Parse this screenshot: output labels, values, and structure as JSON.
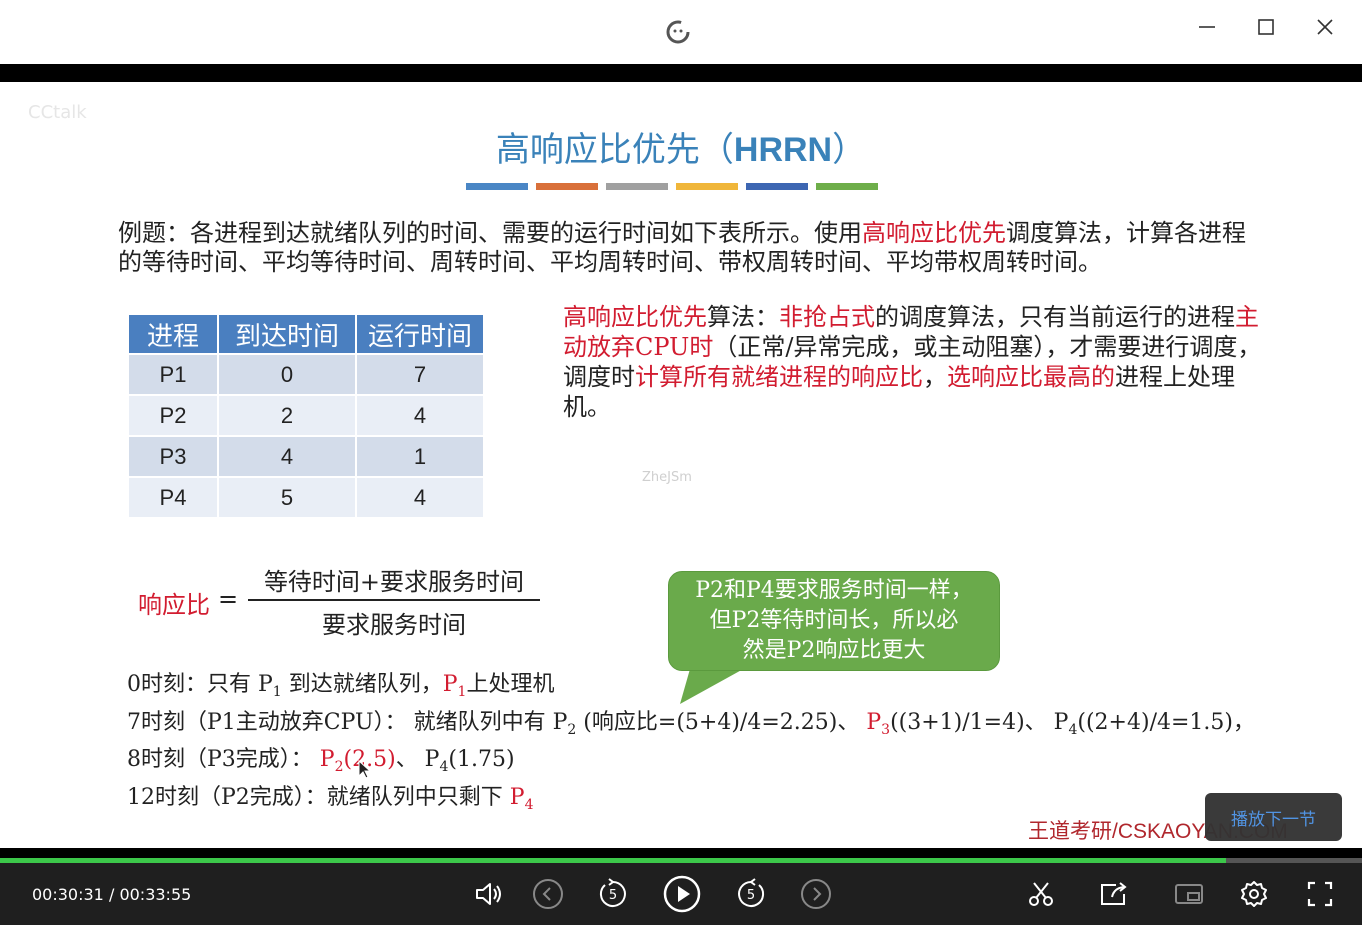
{
  "slide": {
    "watermark": "CCtalk",
    "title_cn": "高响应比优先（",
    "title_abbr": "HRRN",
    "title_close": "）",
    "colorbar_colors": [
      "#4a86c5",
      "#d9703a",
      "#a0a0a0",
      "#f0b63a",
      "#3d66b2",
      "#6eae4a"
    ],
    "problem": {
      "part1": "例题：各进程到达就绪队列的时间、需要的运行时间如下表所示。使用",
      "highlight": "高响应比优先",
      "part2": "调度算法，计算各进程的等待时间、平均等待时间、周转时间、平均周转时间、带权周转时间、平均带权周转时间。"
    },
    "table": {
      "headers": [
        "进程",
        "到达时间",
        "运行时间"
      ],
      "rows": [
        [
          "P1",
          "0",
          "7"
        ],
        [
          "P2",
          "2",
          "4"
        ],
        [
          "P3",
          "4",
          "1"
        ],
        [
          "P4",
          "5",
          "4"
        ]
      ]
    },
    "algorithm": {
      "a1": "高响应比优先",
      "a2": "算法：",
      "a3": "非抢占式",
      "a4": "的调度算法，只有当前运行的进程",
      "a5": "主动放弃CPU时",
      "a6": "（正常/异常完成，或主动阻塞），才需要进行调度，调度时",
      "a7": "计算所有就绪进程的响应比",
      "a8": "，",
      "a9": "选响应比最高的",
      "a10": "进程上处理机。"
    },
    "center_mark": "ZheJSm",
    "formula": {
      "label": "响应比",
      "eq": "=",
      "numerator": "等待时间+要求服务时间",
      "denominator": "要求服务时间"
    },
    "bubble": {
      "line1": "P2和P4要求服务时间一样，",
      "line2": "但P2等待时间长，所以必",
      "line3": "然是P2响应比更大"
    },
    "steps": {
      "s0_a": "0时刻：只有 P",
      "s0_sub1": "1",
      "s0_b": " 到达就绪队列，",
      "s0_red": "P",
      "s0_sub2": "1",
      "s0_c": "上处理机",
      "s7_a": "7时刻（P1主动放弃CPU）： 就绪队列中有 P",
      "s7_sub1": "2",
      "s7_b": " (响应比=(5+4)/4=2.25)、 ",
      "s7_red": "P",
      "s7_sub2": "3",
      "s7_c": "((3+1)/1=4)、 P",
      "s7_sub3": "4",
      "s7_d": "((2+4)/4=1.5)，",
      "s8_a": "8时刻（P3完成）： ",
      "s8_red": "P",
      "s8_sub1": "2",
      "s8_red2": "(2.5)",
      "s8_b": "、 P",
      "s8_sub2": "4",
      "s8_c": "(1.75)",
      "s12_a": "12时刻（P2完成）：就绪队列中只剩下 ",
      "s12_red": "P",
      "s12_sub": "4"
    },
    "brand": "王道考研/CSKAOYAN.COM"
  },
  "player": {
    "next_label": "播放下一节",
    "current_time": "00:30:31",
    "separator": "/",
    "total_time": "00:33:55",
    "progress": 0.9,
    "accent": "#3cc74a"
  }
}
